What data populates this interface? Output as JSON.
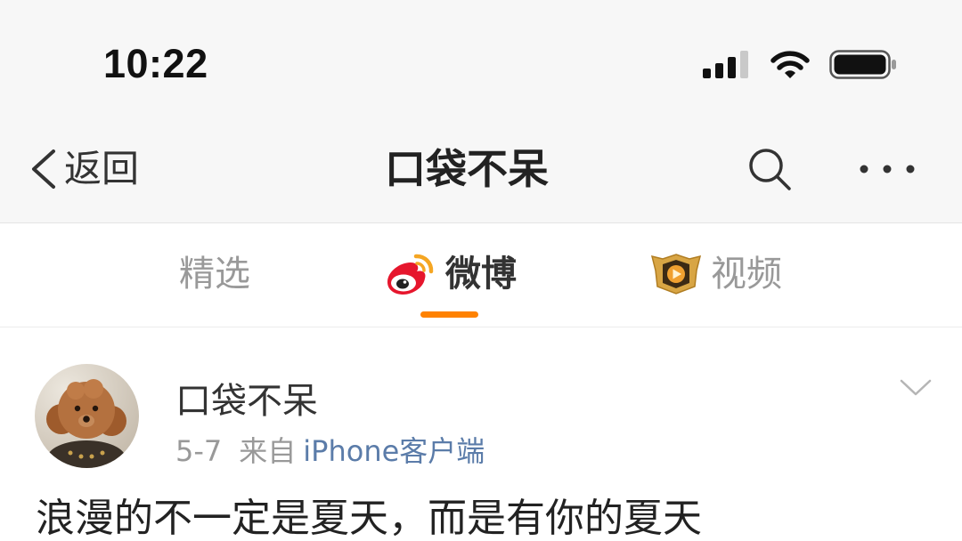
{
  "status_bar": {
    "time": "10:22",
    "icons": [
      "signal-bars-icon",
      "wifi-icon",
      "battery-icon"
    ]
  },
  "nav": {
    "back_label": "返回",
    "title": "口袋不呆",
    "icons": [
      "chevron-left-icon",
      "search-icon",
      "more-icon"
    ]
  },
  "tabs": [
    {
      "label": "精选",
      "active": false
    },
    {
      "label": "微博",
      "active": true,
      "icon": "weibo-logo-icon"
    },
    {
      "label": "视频",
      "active": false,
      "icon": "video-badge-icon"
    }
  ],
  "post": {
    "author": "口袋不呆",
    "date": "5-7",
    "source_prefix": "来自",
    "source": "iPhone客户端",
    "text": "浪漫的不一定是夏天，而是有你的夏天",
    "icons": [
      "avatar",
      "chevron-down-icon"
    ]
  },
  "colors": {
    "header_bg": "#f7f7f7",
    "accent": "#ff8200",
    "link": "#5b7ca9",
    "text": "#333333",
    "muted": "#999999"
  }
}
